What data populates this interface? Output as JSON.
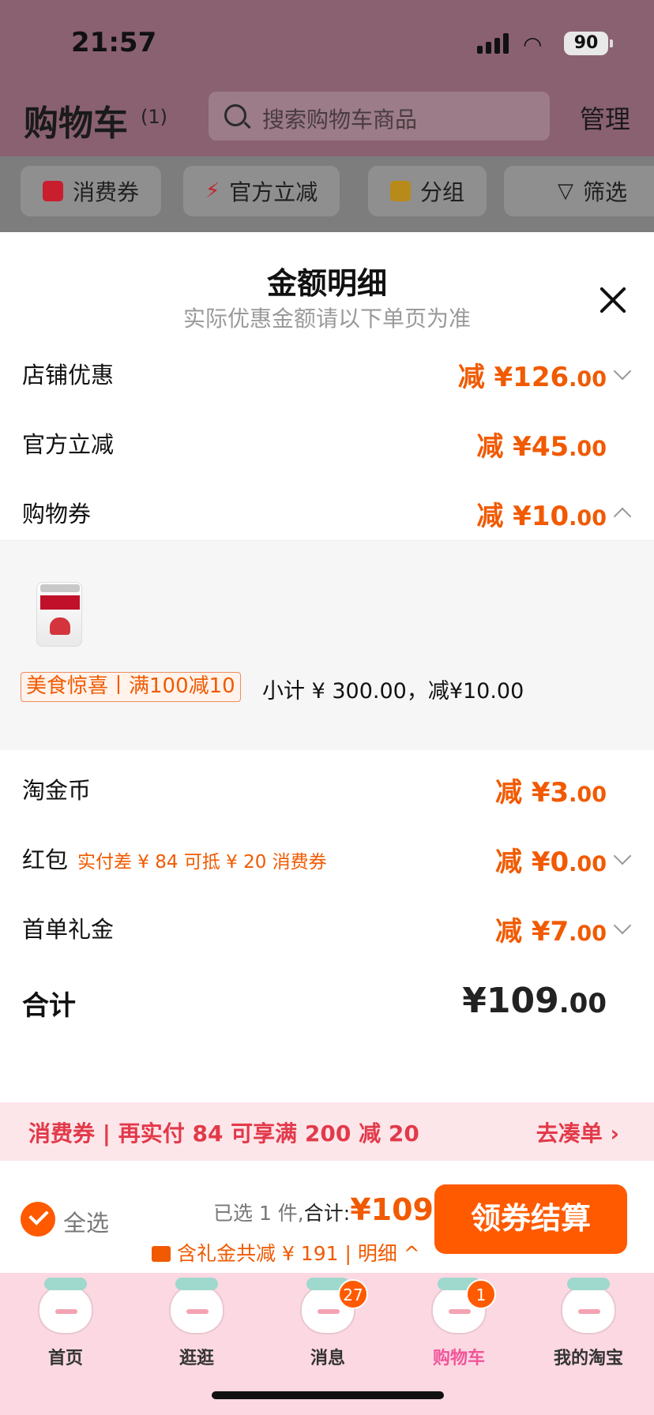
{
  "status_bar": {
    "time": "21:57",
    "battery": "90"
  },
  "header": {
    "title": "购物车",
    "count": "(1)",
    "search_placeholder": "搜索购物车商品",
    "manage": "管理"
  },
  "filters": [
    {
      "label": "消费券",
      "icon": "coupon-icon"
    },
    {
      "label": "官方立减",
      "icon": "lightning-icon"
    },
    {
      "label": "分组",
      "icon": "folder-icon"
    },
    {
      "label": "筛选",
      "icon": "filter-icon"
    }
  ],
  "sheet": {
    "title": "金额明细",
    "subtitle": "实际优惠金额请以下单页为准",
    "rows": [
      {
        "label": "店铺优惠",
        "prefix": "减 ¥126",
        "decimals": ".00",
        "chevron": "down"
      },
      {
        "label": "官方立减",
        "prefix": "减 ¥45",
        "decimals": ".00",
        "chevron": ""
      },
      {
        "label": "购物券",
        "prefix": "减 ¥10",
        "decimals": ".00",
        "chevron": "up"
      }
    ],
    "coupon_detail": {
      "tag": "美食惊喜丨满100减10",
      "subtotal": "小计 ¥ 300.00，减¥10.00"
    },
    "rows2": [
      {
        "label": "淘金币",
        "hint": "",
        "prefix": "减 ¥3",
        "decimals": ".00",
        "chevron": ""
      },
      {
        "label": "红包",
        "hint": "实付差 ¥ 84 可抵 ¥ 20 消费券",
        "prefix": "减 ¥0",
        "decimals": ".00",
        "chevron": "down"
      },
      {
        "label": "首单礼金",
        "hint": "",
        "prefix": "减 ¥7",
        "decimals": ".00",
        "chevron": "down"
      }
    ],
    "total_label": "合计",
    "total_int": "¥109",
    "total_dec": ".00"
  },
  "promo": {
    "text": "消费券 | 再实付 84 可享满 200 减 20",
    "link": "去凑单 ›"
  },
  "checkout": {
    "select_all": "全选",
    "selected": "已选 1 件,",
    "sum_label": "合计:",
    "sum_value": "¥109",
    "discount": "含礼金共减 ¥ 191 | 明细 ^",
    "button": "领券结算"
  },
  "tabs": [
    {
      "label": "首页",
      "badge": ""
    },
    {
      "label": "逛逛",
      "badge": ""
    },
    {
      "label": "消息",
      "badge": "27"
    },
    {
      "label": "购物车",
      "badge": "1"
    },
    {
      "label": "我的淘宝",
      "badge": ""
    }
  ],
  "colors": {
    "accent": "#ff5a00",
    "price": "#f15a00",
    "promo_text": "#e23a4a",
    "tab_active": "#f2559a",
    "tabbar_bg": "#fbd8e2"
  }
}
